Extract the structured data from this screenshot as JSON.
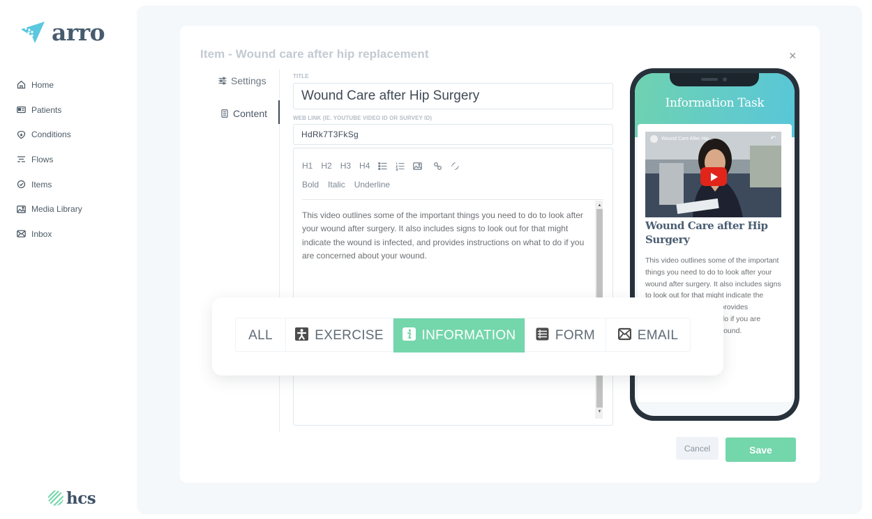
{
  "brand": {
    "name": "arro",
    "footer_brand": "hcs",
    "accent": "#74d6ab",
    "logo_color": "#5bc8e0"
  },
  "sidebar": {
    "items": [
      {
        "label": "Home",
        "icon": "home-icon"
      },
      {
        "label": "Patients",
        "icon": "id-card-icon"
      },
      {
        "label": "Conditions",
        "icon": "heart-shield-icon"
      },
      {
        "label": "Flows",
        "icon": "flows-icon"
      },
      {
        "label": "Items",
        "icon": "check-circle-icon"
      },
      {
        "label": "Media Library",
        "icon": "image-icon"
      },
      {
        "label": "Inbox",
        "icon": "mail-icon"
      }
    ]
  },
  "dialog": {
    "title": "Item - Wound care after hip replacement",
    "close": "×",
    "tabs": [
      {
        "label": "Settings",
        "icon": "sliders-icon",
        "active": false
      },
      {
        "label": "Content",
        "icon": "document-icon",
        "active": true
      }
    ],
    "title_field": {
      "label": "TITLE",
      "value": "Wound Care after Hip Surgery"
    },
    "link_field": {
      "label": "WEB LINK (IE. YOUTUBE VIDEO ID OR SURVEY ID)",
      "value": "HdRk7T3FkSg"
    },
    "editor": {
      "toolbar_row1": [
        "H1",
        "H2",
        "H3",
        "H4"
      ],
      "toolbar_icons": [
        "bullet-list-icon",
        "numbered-list-icon",
        "image-icon",
        "link-icon",
        "unlink-icon"
      ],
      "toolbar_row2": [
        "Bold",
        "Italic",
        "Underline"
      ],
      "content": "This video outlines some of the important things you need to do to look after your wound after surgery.  It also includes signs to look out for that might indicate the wound is infected, and provides instructions on what to do if you are concerned about your wound."
    },
    "preview": {
      "header": "Information Task",
      "video_title": "Wound Care After Hip...",
      "card_title": "Wound Care after Hip Surgery",
      "card_body": "This video outlines some of the important things you need to do to look after your wound after surgery.  It also includes signs to look out for that might indicate the wound is infected, and provides instructions on what to do if you are concerned about your wound."
    },
    "buttons": {
      "cancel": "Cancel",
      "save": "Save"
    }
  },
  "category_filter": {
    "options": [
      {
        "label": "ALL",
        "icon": null,
        "active": false
      },
      {
        "label": "EXERCISE",
        "icon": "exercise-icon",
        "active": false
      },
      {
        "label": "INFORMATION",
        "icon": "info-icon",
        "active": true
      },
      {
        "label": "FORM",
        "icon": "form-icon",
        "active": false
      },
      {
        "label": "EMAIL",
        "icon": "email-icon",
        "active": false
      }
    ]
  }
}
